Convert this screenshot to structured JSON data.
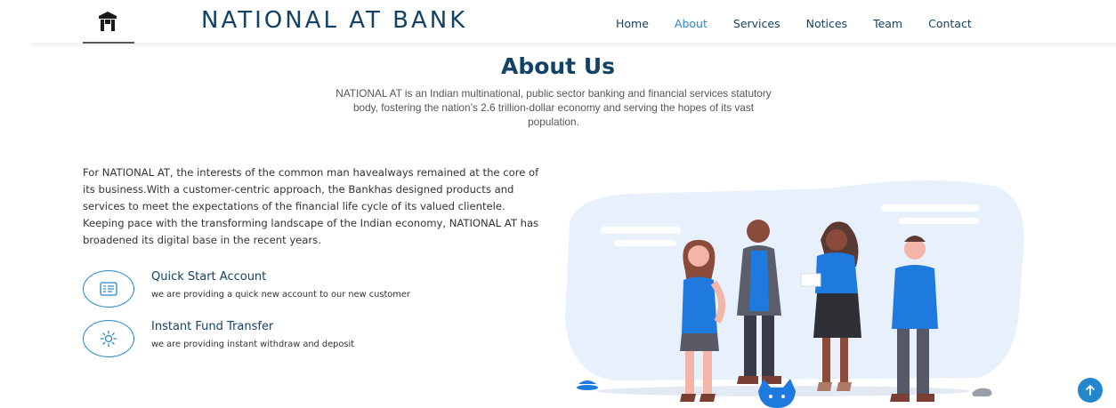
{
  "header": {
    "brand": "NATIONAL AT BANK",
    "logo_icon": "bank-logo-icon",
    "nav": [
      {
        "label": "Home",
        "active": false
      },
      {
        "label": "About",
        "active": true
      },
      {
        "label": "Services",
        "active": false
      },
      {
        "label": "Notices",
        "active": false
      },
      {
        "label": "Team",
        "active": false
      },
      {
        "label": "Contact",
        "active": false
      }
    ]
  },
  "about": {
    "title": "About Us",
    "subtitle": "NATIONAL AT is an Indian multinational, public sector banking and financial services statutory body, fostering the nation’s 2.6 trillion-dollar economy and serving the hopes of its vast population.",
    "body": "For NATIONAL AT, the interests of the common man havealways remained at the core of its business.With a customer-centric approach, the Bankhas designed products and services to meet the expectations of the financial life cycle of its valued clientele. Keeping pace with the transforming landscape of the Indian economy, NATIONAL AT has broadened its digital base in the recent years.",
    "features": [
      {
        "icon": "id-card-icon",
        "title": "Quick Start Account",
        "desc": "we are providing a quick new account to our new customer"
      },
      {
        "icon": "sun-icon",
        "title": "Instant Fund Transfer",
        "desc": "we are providing instant withdraw and deposit"
      }
    ]
  },
  "colors": {
    "primary": "#2487ce",
    "heading": "#124265",
    "text": "#444444",
    "illustration_bg": "#e8f1fb"
  },
  "back_to_top_icon": "arrow-up-icon"
}
